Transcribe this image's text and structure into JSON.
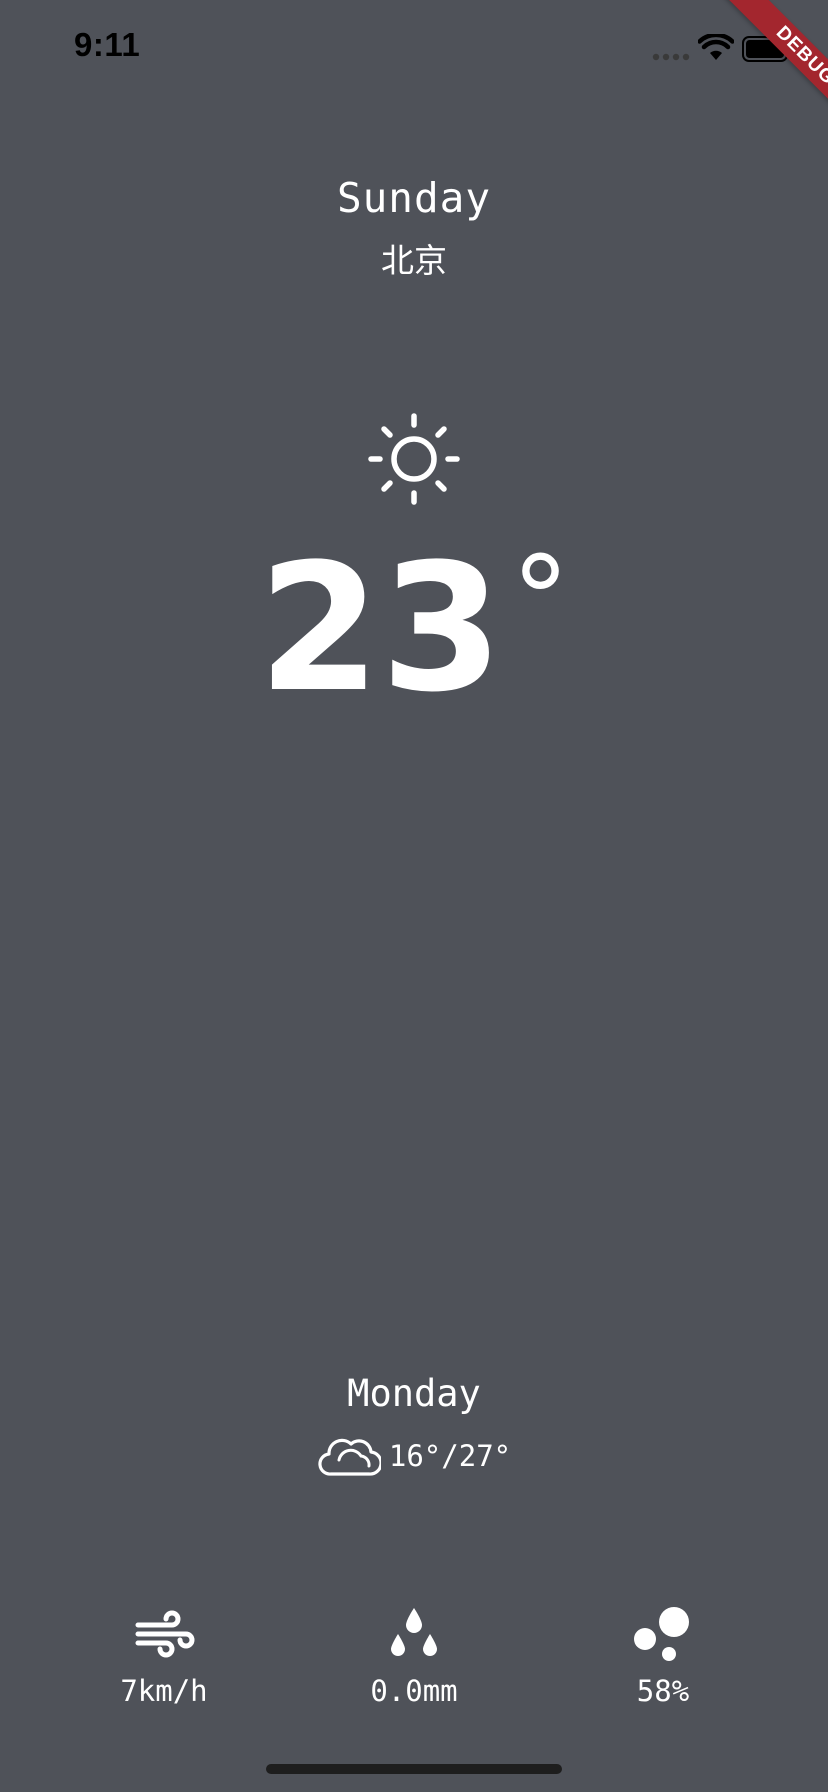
{
  "status_bar": {
    "time": "9:11",
    "icons": [
      "signal-dots-icon",
      "wifi-icon",
      "battery-icon"
    ]
  },
  "debug_banner": {
    "label": "DEBUG",
    "color": "#a3262e"
  },
  "current": {
    "day": "Sunday",
    "city": "北京",
    "condition_icon": "sun-icon",
    "temperature": "23",
    "degree_symbol": "°"
  },
  "forecast": {
    "day": "Monday",
    "condition_icon": "cloud-icon",
    "range": "16°/27°"
  },
  "stats": {
    "wind": {
      "icon": "wind-icon",
      "value": "7km/h"
    },
    "rain": {
      "icon": "raindrops-icon",
      "value": "0.0mm"
    },
    "humidity": {
      "icon": "bubbles-icon",
      "value": "58%"
    }
  },
  "colors": {
    "background": "#4f5259",
    "foreground": "#ffffff"
  }
}
